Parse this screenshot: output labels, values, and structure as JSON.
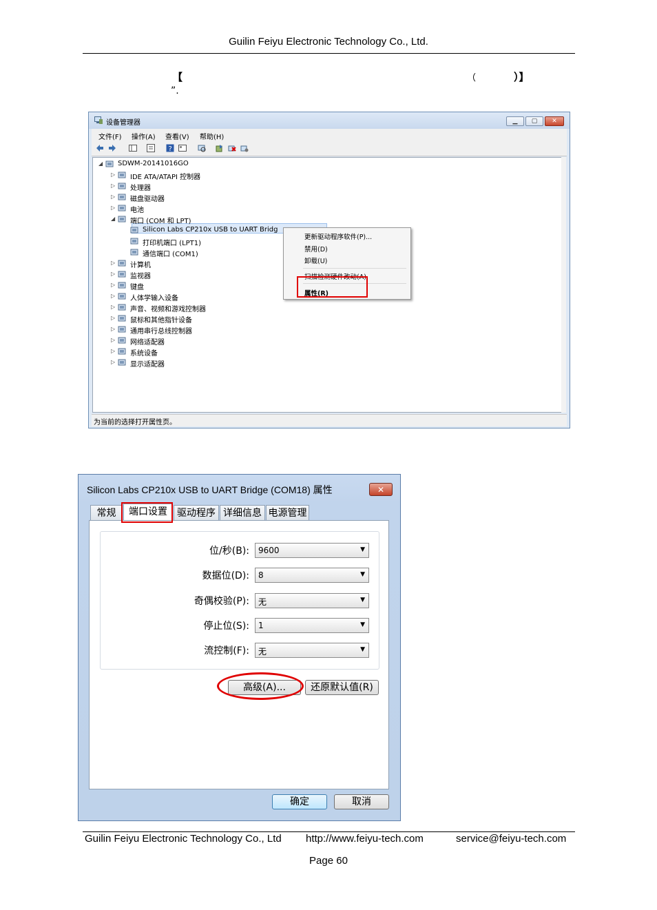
{
  "header": {
    "company": "Guilin Feiyu Electronic Technology Co., Ltd.",
    "bracket_open": "【",
    "paren_open": "（",
    "paren_close_bracket": "）】",
    "quote_dot": "”."
  },
  "device_manager": {
    "title": "设备管理器",
    "menu": [
      "文件(F)",
      "操作(A)",
      "查看(V)",
      "帮助(H)"
    ],
    "tree": [
      {
        "label": "SDWM-20141016GO",
        "arrow": "◢",
        "icon": "computer-icon"
      },
      {
        "label": "IDE ATA/ATAPI 控制器",
        "arrow": "▷",
        "icon": "ide-controller-icon"
      },
      {
        "label": "处理器",
        "arrow": "▷",
        "icon": "processor-icon"
      },
      {
        "label": "磁盘驱动器",
        "arrow": "▷",
        "icon": "disk-drive-icon"
      },
      {
        "label": "电池",
        "arrow": "▷",
        "icon": "battery-icon"
      },
      {
        "label": "端口 (COM 和 LPT)",
        "arrow": "◢",
        "icon": "port-icon"
      },
      {
        "label": "Silicon Labs CP210x USB to UART Bridg",
        "arrow": "",
        "icon": "port-icon"
      },
      {
        "label": "打印机端口 (LPT1)",
        "arrow": "",
        "icon": "port-icon"
      },
      {
        "label": "通信端口 (COM1)",
        "arrow": "",
        "icon": "port-icon"
      },
      {
        "label": "计算机",
        "arrow": "▷",
        "icon": "computer-icon"
      },
      {
        "label": "监视器",
        "arrow": "▷",
        "icon": "monitor-icon"
      },
      {
        "label": "键盘",
        "arrow": "▷",
        "icon": "keyboard-icon"
      },
      {
        "label": "人体学输入设备",
        "arrow": "▷",
        "icon": "hid-icon"
      },
      {
        "label": "声音、视频和游戏控制器",
        "arrow": "▷",
        "icon": "sound-icon"
      },
      {
        "label": "鼠标和其他指针设备",
        "arrow": "▷",
        "icon": "mouse-icon"
      },
      {
        "label": "通用串行总线控制器",
        "arrow": "▷",
        "icon": "usb-icon"
      },
      {
        "label": "网络适配器",
        "arrow": "▷",
        "icon": "network-icon"
      },
      {
        "label": "系统设备",
        "arrow": "▷",
        "icon": "system-icon"
      },
      {
        "label": "显示适配器",
        "arrow": "▷",
        "icon": "display-icon"
      }
    ],
    "context_menu": {
      "update": "更新驱动程序软件(P)...",
      "disable": "禁用(D)",
      "uninstall": "卸载(U)",
      "scan": "扫描检测硬件改动(A)",
      "properties": "属性(R)"
    },
    "status": "为当前的选择打开属性页。"
  },
  "properties_dialog": {
    "title": "Silicon Labs CP210x USB to UART Bridge (COM18) 属性",
    "tabs": [
      "常规",
      "端口设置",
      "驱动程序",
      "详细信息",
      "电源管理"
    ],
    "fields": [
      {
        "label": "位/秒(B):",
        "value": "9600"
      },
      {
        "label": "数据位(D):",
        "value": "8"
      },
      {
        "label": "奇偶校验(P):",
        "value": "无"
      },
      {
        "label": "停止位(S):",
        "value": "1"
      },
      {
        "label": "流控制(F):",
        "value": "无"
      }
    ],
    "advanced_button": "高级(A)...",
    "restore_button": "还原默认值(R)",
    "ok_button": "确定",
    "cancel_button": "取消"
  },
  "footer": {
    "company": "Guilin Feiyu Electronic Technology Co., Ltd",
    "url": "http://www.feiyu-tech.com",
    "email": "service@feiyu-tech.com",
    "page": "Page 60"
  },
  "colors": {
    "highlight_red": "#e00000",
    "window_frame": "#6d8fb5",
    "selection": "#dce9f9"
  }
}
